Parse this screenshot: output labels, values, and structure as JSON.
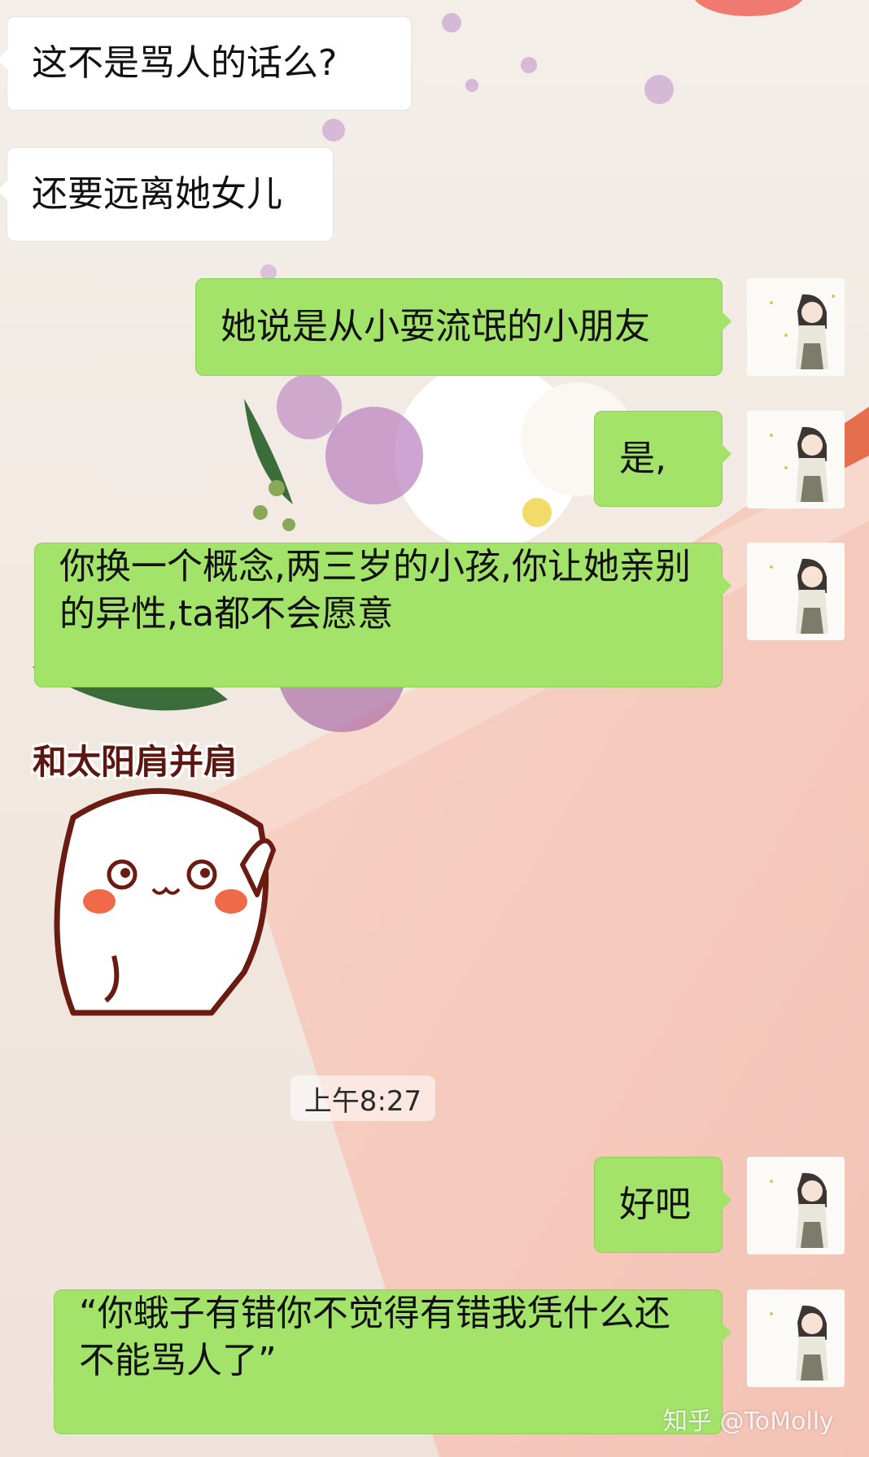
{
  "chat": {
    "messages": [
      {
        "text": "这不是骂人的话么?"
      },
      {
        "text": "还要远离她女儿"
      },
      {
        "text": "她说是从小耍流氓的小朋友"
      },
      {
        "text": "是,"
      },
      {
        "text": "你换一个概念,两三岁的小孩,你让她亲别的异性,ta都不会愿意"
      },
      {
        "text": "好吧"
      },
      {
        "text": "“你蛾子有错你不觉得有错我凭什么还不能骂人了”"
      }
    ],
    "sticker": {
      "text": "和太阳肩并肩"
    },
    "timestamp": "上午8:27",
    "watermark": "知乎 @ToMolly"
  },
  "colors": {
    "sent_bubble": "#a3e36a",
    "received_bubble": "#ffffff",
    "background": "#f4ece6"
  }
}
